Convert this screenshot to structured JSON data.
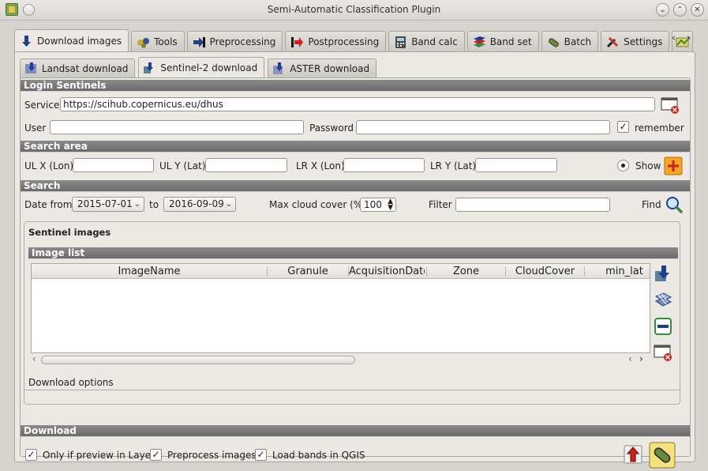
{
  "window": {
    "title": "Semi-Automatic Classification Plugin",
    "buttons": [
      "chevron-down-icon",
      "chevron-up-icon",
      "close-icon"
    ]
  },
  "main_tabs": [
    {
      "label": "Download images",
      "icon": "download-arrow-icon",
      "active": true
    },
    {
      "label": "Tools",
      "icon": "tools-icon"
    },
    {
      "label": "Preprocessing",
      "icon": "preprocessing-icon"
    },
    {
      "label": "Postprocessing",
      "icon": "postprocessing-icon"
    },
    {
      "label": "Band calc",
      "icon": "band-calc-icon"
    },
    {
      "label": "Band set",
      "icon": "band-set-icon"
    },
    {
      "label": "Batch",
      "icon": "batch-icon"
    },
    {
      "label": "Settings",
      "icon": "settings-icon"
    }
  ],
  "sub_tabs": [
    {
      "label": "Landsat download",
      "active": false
    },
    {
      "label": "Sentinel-2 download",
      "active": true
    },
    {
      "label": "ASTER download",
      "active": false
    }
  ],
  "login": {
    "header": "Login Sentinels",
    "service_label": "Service",
    "service_value": "https://scihub.copernicus.eu/dhus",
    "user_label": "User",
    "user_value": "",
    "password_label": "Password",
    "password_value": "",
    "remember_label": "remember",
    "remember_checked": true
  },
  "search_area": {
    "header": "Search area",
    "ulx_label": "UL X (Lon)",
    "uly_label": "UL Y (Lat)",
    "lrx_label": "LR X (Lon)",
    "lry_label": "LR Y (Lat)",
    "show_label": "Show"
  },
  "search": {
    "header": "Search",
    "date_from_label": "Date from",
    "date_from": "2015-07-01",
    "to_label": "to",
    "date_to": "2016-09-09",
    "cloud_label": "Max cloud cover (%)",
    "cloud_value": "100",
    "filter_label": "Filter",
    "find_label": "Find"
  },
  "images": {
    "group_title": "Sentinel images",
    "list_header": "Image list",
    "columns": [
      "ImageName",
      "Granule",
      "AcquisitionDate",
      "Zone",
      "CloudCover",
      "min_lat"
    ],
    "download_options_label": "Download options"
  },
  "download": {
    "header": "Download",
    "only_preview_label": "Only if preview in Layers",
    "preprocess_label": "Preprocess images",
    "load_bands_label": "Load bands in QGIS"
  }
}
